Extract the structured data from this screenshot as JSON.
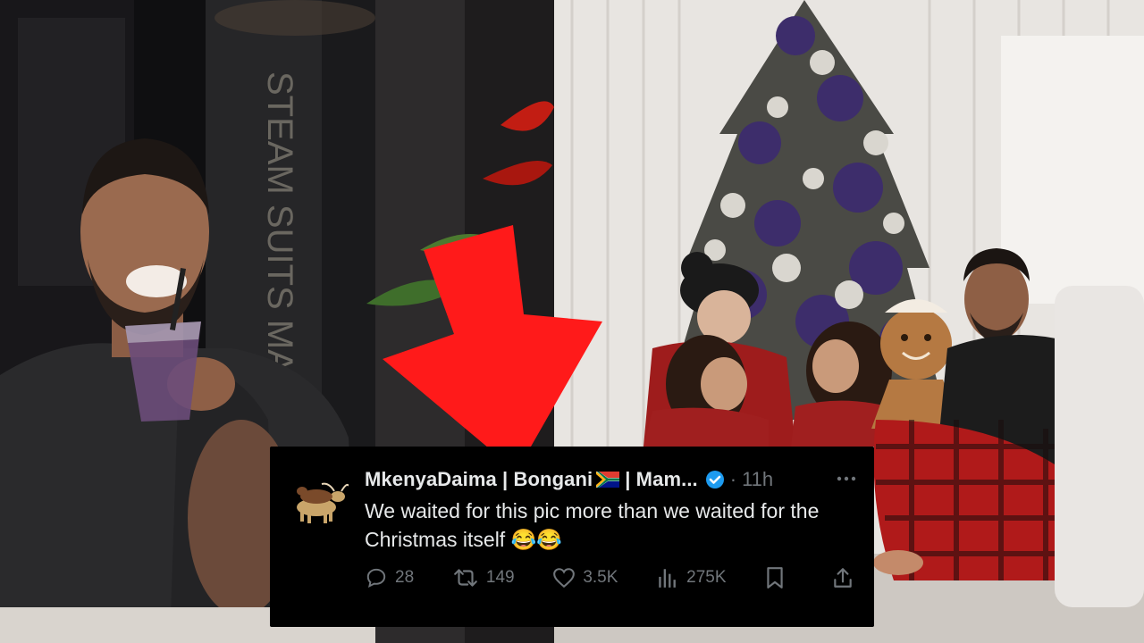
{
  "scene_left": {
    "sign_text": "STEAM SUITS MA"
  },
  "tweet": {
    "author": "MkenyaDaima | Bongani",
    "author_suffix": "| Mam...",
    "dot": "·",
    "time": "11h",
    "text": "We waited for this pic more than we waited for the Christmas itself 😂😂",
    "replies": "28",
    "retweets": "149",
    "likes": "3.5K",
    "views": "275K"
  },
  "colors": {
    "arrow": "#ff1a1a",
    "verified": "#1d9bf0",
    "card_bg": "#000000"
  },
  "icons": [
    "reply-icon",
    "retweet-icon",
    "like-icon",
    "views-icon",
    "bookmark-icon",
    "share-icon",
    "verified-badge-icon",
    "more-icon",
    "down-arrow-icon"
  ]
}
